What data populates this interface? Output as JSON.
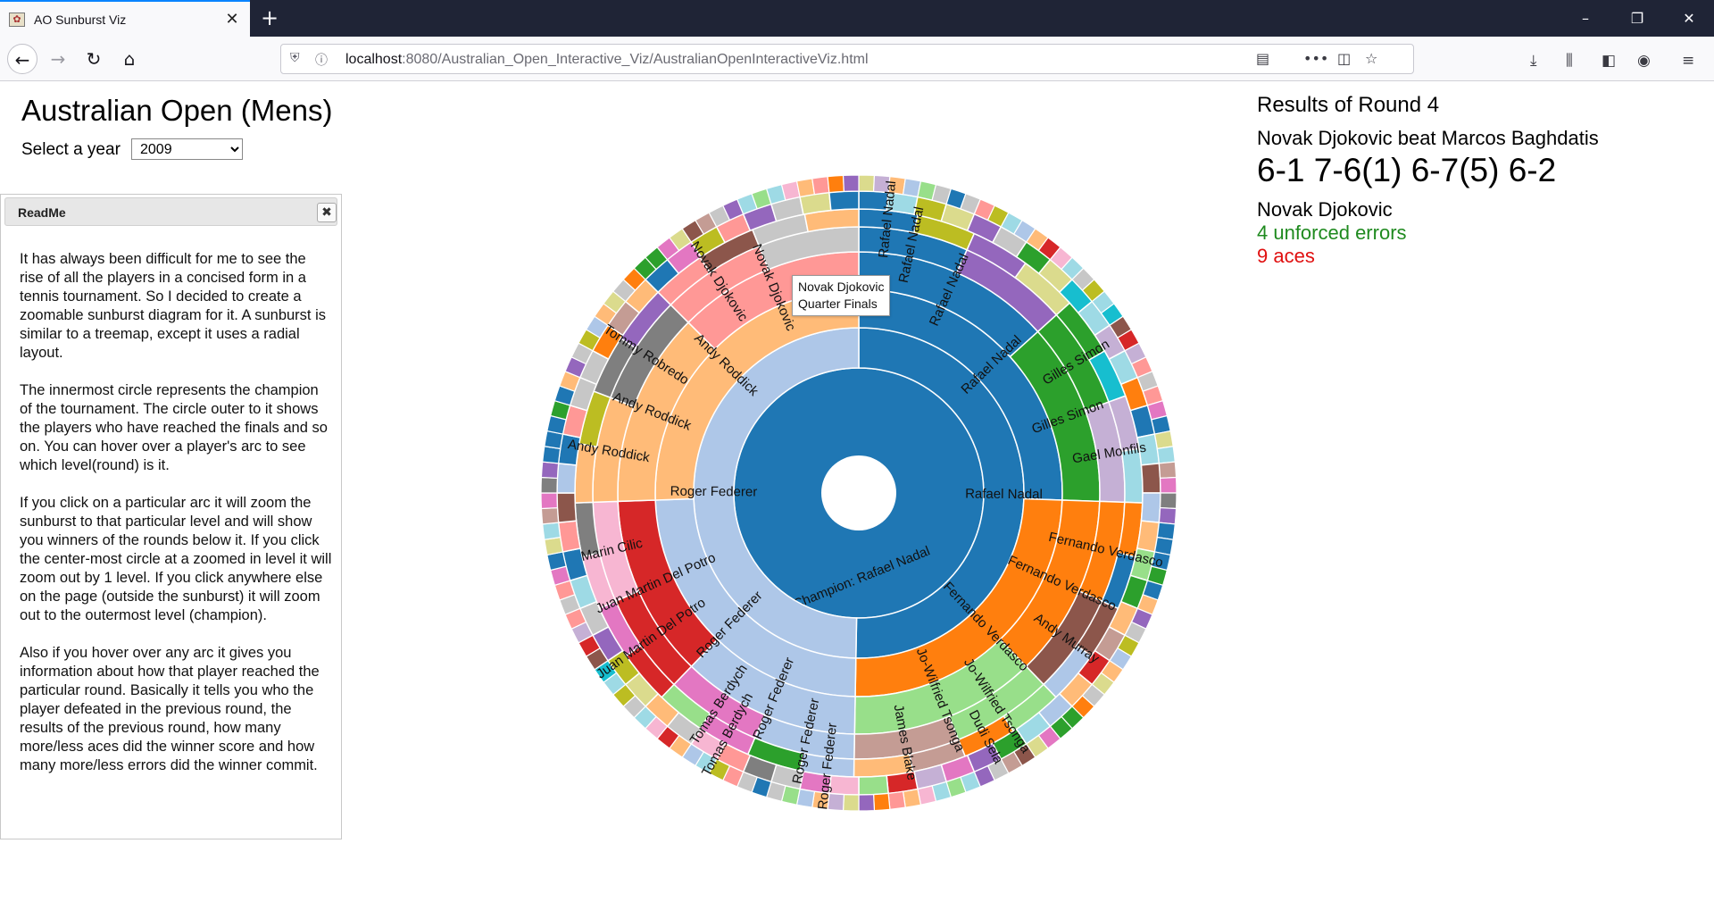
{
  "browser": {
    "tab_title": "AO Sunburst Viz",
    "url_host": "localhost",
    "url_rest": ":8080/Australian_Open_Interactive_Viz/AustralianOpenInteractiveViz.html"
  },
  "page": {
    "title": "Australian Open (Mens)",
    "year_label": "Select a year",
    "year_selected": "2009"
  },
  "readme": {
    "title": "ReadMe",
    "paragraphs": [
      "It has always been difficult for me to see the rise of all the players in a concised form in a tennis tournament. So I decided to create a zoomable sunburst diagram for it. A sunburst is similar to a treemap, except it uses a radial layout.",
      "The innermost circle represents the champion of the tournament. The circle outer to it shows the players who have reached the finals and so on. You can hover over a player's arc to see which level(round) is it.",
      "If you click on a particular arc it will zoom the sunburst to that particular level and will show you winners of the rounds below it. If you click the center-most circle at a zoomed in level it will zoom out by 1 level. If you click anywhere else on the page (outside the sunburst) it will zoom out to the outermost level (champion).",
      "Also if you hover over any arc it gives you information about how that player reached the particular round. Basically it tells you who the player defeated in the previous round, the results of the previous round, how many more/less aces did the winner score and how many more/less errors did the winner commit."
    ]
  },
  "results": {
    "round": "Results of Round 4",
    "match": "Novak Djokovic beat Marcos Baghdatis",
    "score": "6-1 7-6(1) 6-7(5) 6-2",
    "player": "Novak Djokovic",
    "errors": "4 unforced errors",
    "aces": "9 aces"
  },
  "tooltip": {
    "line1": "Novak Djokovic",
    "line2": "Quarter Finals"
  },
  "sunburst": {
    "champion_label": "Champion: Rafael Nadal",
    "colors": {
      "nadal": "#1f77b4",
      "federer": "#aec7e8",
      "verdasco": "#ff7f0e",
      "roddick": "#ffbb78",
      "djokovic": "#ff9896",
      "delpotro": "#d62728",
      "tsonga": "#98df8a",
      "simon": "#2ca02c",
      "monfils": "#c5b0d5",
      "blake": "#c49c94",
      "berdych": "#e377c2",
      "cilic": "#f7b6d2",
      "murray": "#8c564b",
      "robredo": "#7f7f7f",
      "sela": "#ff7f0e",
      "gray": "#c7c7c7",
      "olive": "#bcbd22",
      "khaki": "#dbdb8d",
      "cyan": "#17becf",
      "lightcyan": "#9edae5",
      "purple": "#9467bd",
      "darkgreen": "#2ca02c"
    },
    "labels": {
      "final_nadal": "Rafael Nadal",
      "final_federer": "Roger Federer",
      "sf_nadal": "Rafael Nadal",
      "sf_verdasco": "Fernando Verdasco",
      "sf_federer": "Roger Federer",
      "sf_roddick": "Andy Roddick",
      "qf_nadal": "Rafael Nadal",
      "qf_simon": "Gilles Simon",
      "qf_verdasco": "Fernando Verdasco",
      "qf_tsonga": "Jo-Wilfried Tsonga",
      "qf_federer": "Roger Federer",
      "qf_delpotro": "Juan Martin Del Potro",
      "qf_roddick": "Andy Roddick",
      "qf_djokovic": "Novak Djokovic",
      "r4_nadal": "Rafael Nadal",
      "r4_simon": "Gilles Simon",
      "r4_monfils": "Gael Monfils",
      "r4_verdasco": "Fernando Verdasco",
      "r4_murray": "Andy Murray",
      "r4_tsonga": "Jo-Wilfried Tsonga",
      "r4_blake": "James Blake",
      "r4_federer": "Roger Federer",
      "r4_berdych": "Tomas Berdych",
      "r4_delpotro": "Juan Martin Del Potro",
      "r4_cilic": "Marin Cilic",
      "r4_roddick": "Andy Roddick",
      "r4_robredo": "Tommy Robredo",
      "r4_djokovic": "Novak Djokovic",
      "r3_nadal": "Rafael Nadal",
      "r3_sela": "Dudi Sela",
      "r3_berdych": "Tomas Berdych",
      "r3_federer": "Roger Federer"
    }
  }
}
